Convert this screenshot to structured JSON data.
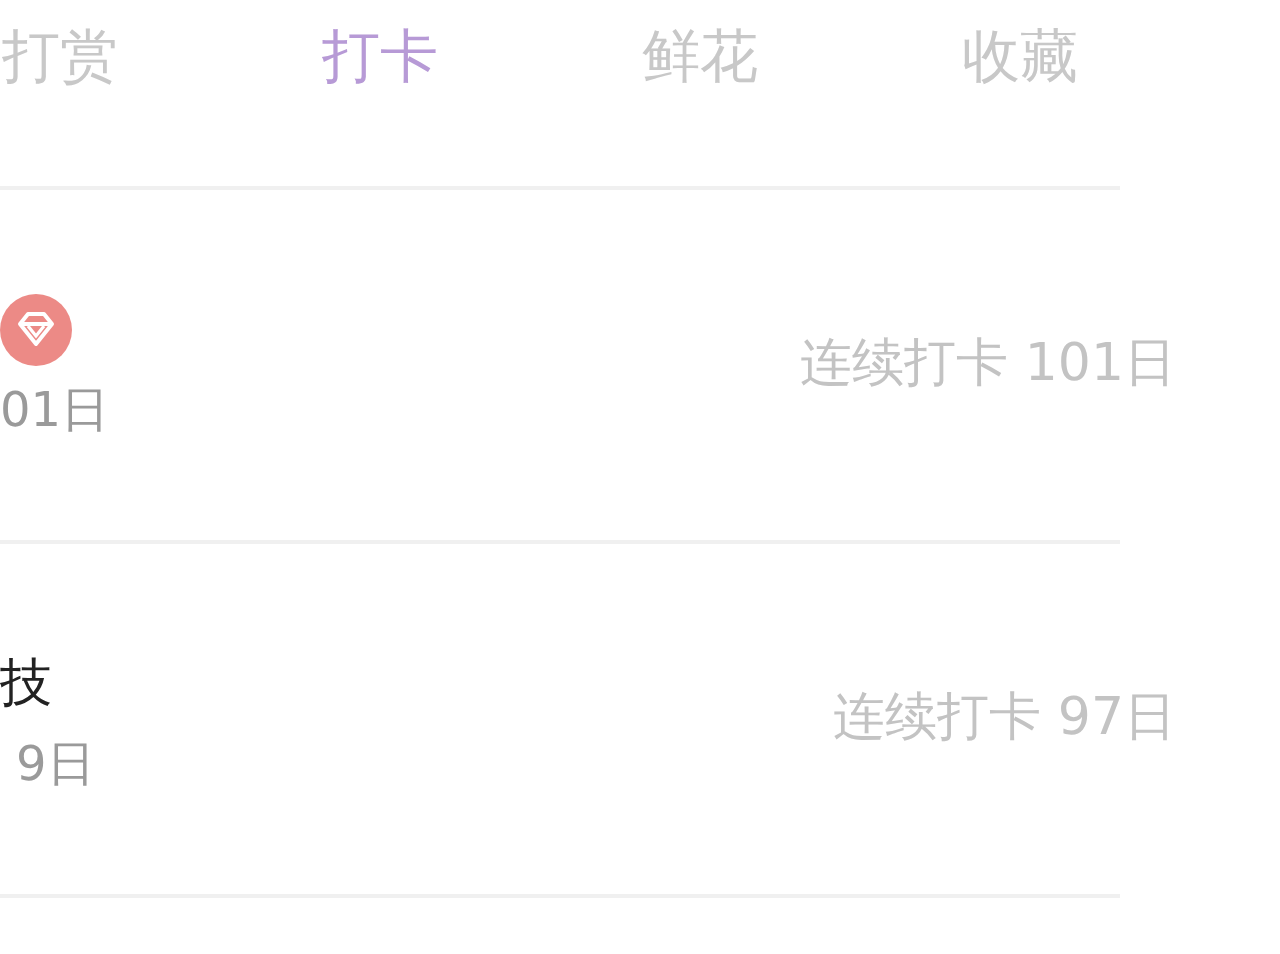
{
  "tabs": [
    {
      "label": "打赏",
      "selected": false
    },
    {
      "label": "打卡",
      "selected": true
    },
    {
      "label": "鲜花",
      "selected": false
    },
    {
      "label": "收藏",
      "selected": false
    }
  ],
  "records": [
    {
      "badge": true,
      "days": "01日",
      "streak": "连续打卡 101日"
    },
    {
      "name": "技",
      "badge": false,
      "days": "9日",
      "streak": "连续打卡 97日"
    }
  ]
}
